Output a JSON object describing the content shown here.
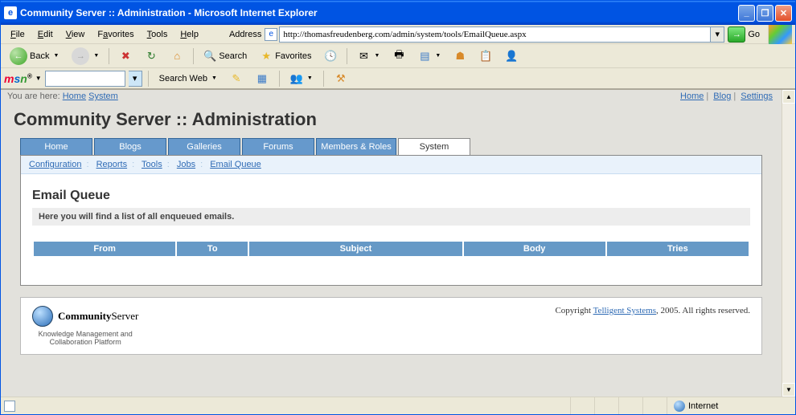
{
  "window": {
    "title": "Community Server :: Administration - Microsoft Internet Explorer"
  },
  "menu": {
    "file": "File",
    "edit": "Edit",
    "view": "View",
    "favorites": "Favorites",
    "tools": "Tools",
    "help": "Help",
    "address_label": "Address",
    "url": "http://thomasfreudenberg.com/admin/system/tools/EmailQueue.aspx",
    "go": "Go"
  },
  "toolbar": {
    "back": "Back",
    "search": "Search",
    "favorites": "Favorites"
  },
  "msn": {
    "search_web": "Search Web"
  },
  "breadcrumb": {
    "prefix": "You are here:",
    "home": "Home",
    "system": "System",
    "rhome": "Home",
    "blog": "Blog",
    "settings": "Settings"
  },
  "page": {
    "h1": "Community Server :: Administration"
  },
  "tabs": {
    "home": "Home",
    "blogs": "Blogs",
    "galleries": "Galleries",
    "forums": "Forums",
    "members": "Members & Roles",
    "system": "System"
  },
  "subnav": {
    "configuration": "Configuration",
    "reports": "Reports",
    "tools": "Tools",
    "jobs": "Jobs",
    "email_queue": "Email Queue"
  },
  "section": {
    "title": "Email Queue",
    "desc": "Here you will find a list of all enqueued emails."
  },
  "table": {
    "from": "From",
    "to": "To",
    "subject": "Subject",
    "body": "Body",
    "tries": "Tries",
    "rows": []
  },
  "footer": {
    "brand1": "Community",
    "brand2": "Server",
    "tagline1": "Knowledge Management and",
    "tagline2": "Collaboration Platform",
    "copy_pre": "Copyright ",
    "copy_link": "Telligent Systems",
    "copy_post": ", 2005. All rights reserved."
  },
  "status": {
    "zone": "Internet"
  }
}
